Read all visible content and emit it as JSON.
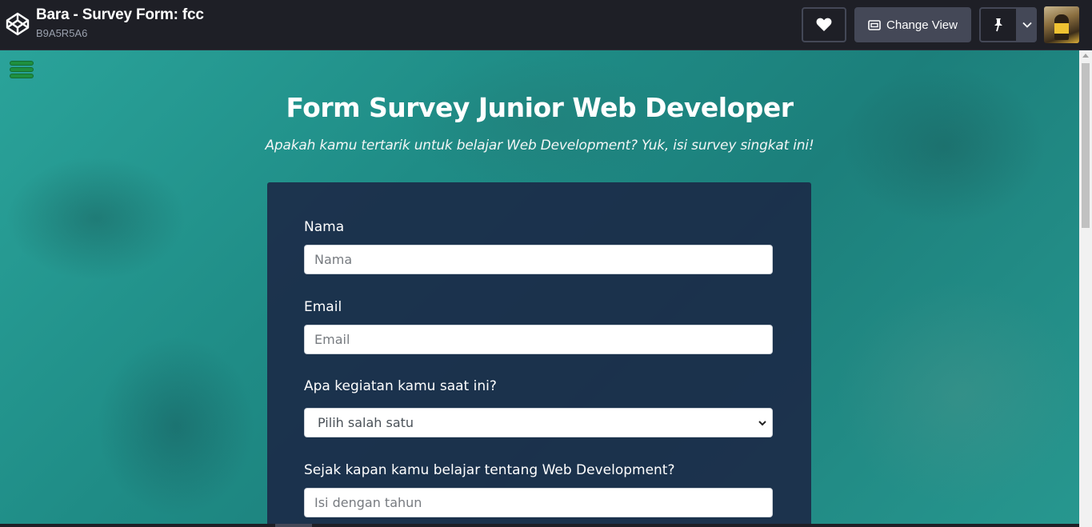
{
  "topbar": {
    "title": "Bara - Survey Form: fcc",
    "subtitle": "B9A5R5A6",
    "change_view_label": "Change View",
    "icons": [
      "codepen-logo-icon",
      "heart-icon",
      "change-view-icon",
      "pin-icon",
      "chevron-down-icon"
    ]
  },
  "page": {
    "title": "Form Survey Junior Web Developer",
    "description": "Apakah kamu tertarik untuk belajar Web Development? Yuk, isi survey singkat ini!"
  },
  "form": {
    "name_label": "Nama",
    "name_placeholder": "Nama",
    "email_label": "Email",
    "email_placeholder": "Email",
    "activity_label": "Apa kegiatan kamu saat ini?",
    "activity_selected": "Pilih salah satu",
    "since_label": "Sejak kapan kamu belajar tentang Web Development?",
    "since_placeholder": "Isi dengan tahun"
  },
  "colors": {
    "topbar_bg": "#1e1f26",
    "button_bg": "#444857",
    "preview_bg": "#1f8c86",
    "card_bg": "#1b2746",
    "hamburger": "#1e8f3f"
  }
}
